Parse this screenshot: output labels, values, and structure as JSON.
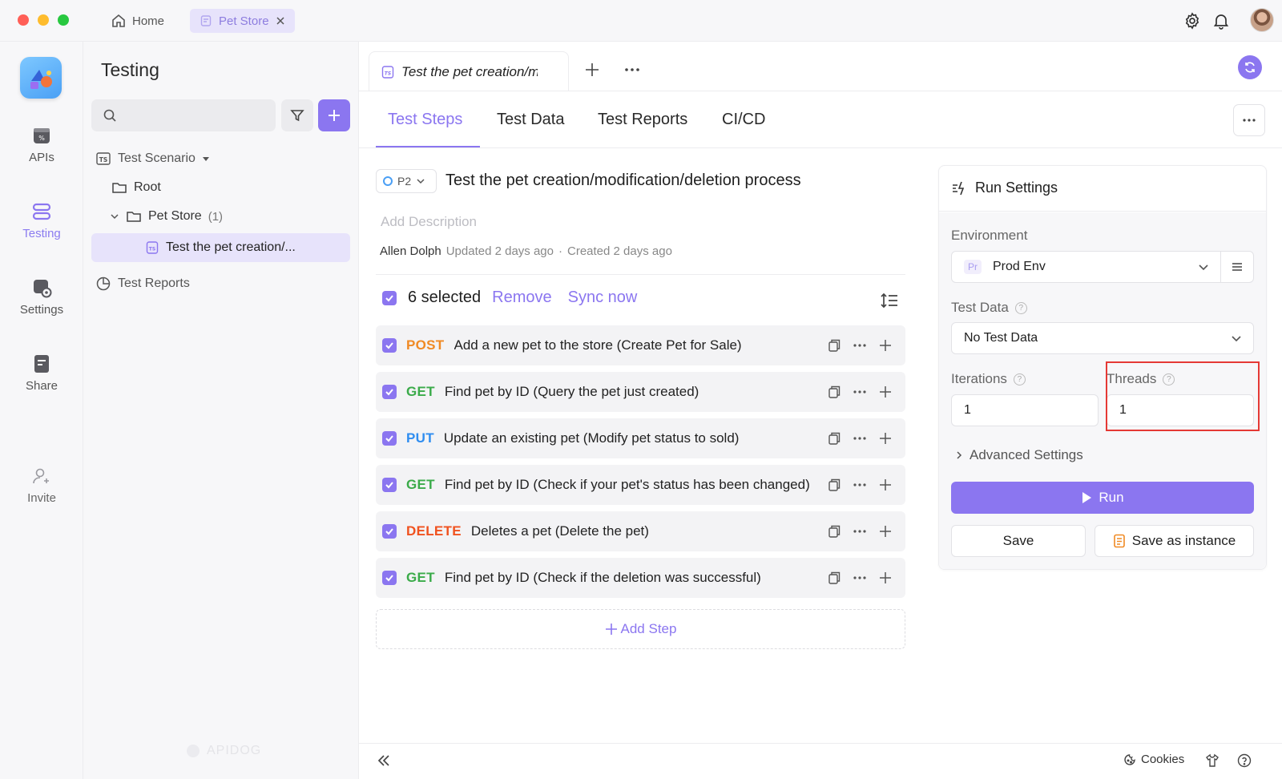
{
  "window": {
    "tabs": [
      {
        "label": "Home"
      },
      {
        "label": "Pet Store"
      }
    ]
  },
  "rail": {
    "items": [
      {
        "label": "APIs"
      },
      {
        "label": "Testing"
      },
      {
        "label": "Settings"
      },
      {
        "label": "Share"
      },
      {
        "label": "Invite"
      }
    ]
  },
  "tree": {
    "title": "Testing",
    "search_placeholder": "",
    "scenario_root": "Test Scenario",
    "root_folder": "Root",
    "folder": {
      "label": "Pet Store",
      "count": "(1)"
    },
    "selected_item": "Test the pet creation/...",
    "reports": "Test Reports",
    "watermark": "APIDOG"
  },
  "main": {
    "file_tab": "Test the pet creation/modification/deletion process",
    "subtabs": [
      {
        "label": "Test Steps",
        "active": true
      },
      {
        "label": "Test Data"
      },
      {
        "label": "Test Reports"
      },
      {
        "label": "CI/CD"
      }
    ],
    "priority": "P2",
    "scenario_title": "Test the pet creation/modification/deletion process",
    "description_placeholder": "Add Description",
    "author": "Allen Dolph",
    "updated": "Updated 2 days ago",
    "separator": "·",
    "created": "Created 2 days ago",
    "selection": {
      "count_label": "6 selected",
      "remove": "Remove",
      "sync": "Sync now"
    },
    "steps": [
      {
        "method": "POST",
        "title": "Add a new pet to the store (Create Pet for Sale)"
      },
      {
        "method": "GET",
        "title": "Find pet by ID (Query the pet just created)"
      },
      {
        "method": "PUT",
        "title": "Update an existing pet (Modify pet status to sold)"
      },
      {
        "method": "GET",
        "title": "Find pet by ID (Check if your pet's status has been changed)"
      },
      {
        "method": "DELETE",
        "title": "Deletes a pet (Delete the pet)"
      },
      {
        "method": "GET",
        "title": "Find pet by ID (Check if the deletion was successful)"
      }
    ],
    "add_step": "Add Step"
  },
  "run_settings": {
    "title": "Run Settings",
    "environment_label": "Environment",
    "environment_badge": "Pr",
    "environment_value": "Prod Env",
    "test_data_label": "Test Data",
    "test_data_value": "No Test Data",
    "iterations_label": "Iterations",
    "iterations_value": "1",
    "threads_label": "Threads",
    "threads_value": "1",
    "advanced": "Advanced Settings",
    "run": "Run",
    "save": "Save",
    "save_instance": "Save as instance"
  },
  "footer": {
    "cookies": "Cookies"
  },
  "colors": {
    "accent": "#8b76f0",
    "post": "#f08a24",
    "get": "#3bab4a",
    "put": "#2f8df0",
    "delete": "#f0521f",
    "highlight_box": "#e53935"
  }
}
